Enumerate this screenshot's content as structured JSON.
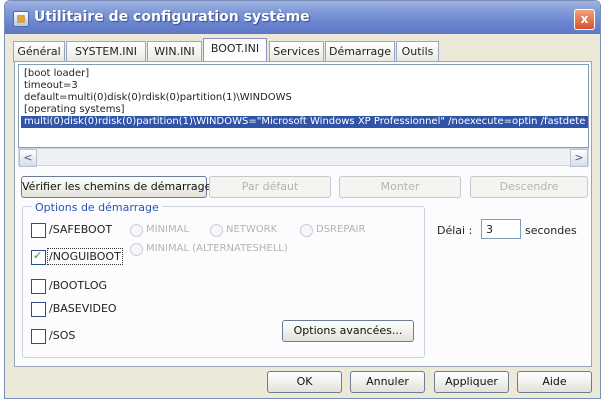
{
  "window": {
    "title": "Utilitaire de configuration système",
    "close_glyph": "x"
  },
  "tabs": [
    "Général",
    "SYSTEM.INI",
    "WIN.INI",
    "BOOT.INI",
    "Services",
    "Démarrage",
    "Outils"
  ],
  "active_tab": "BOOT.INI",
  "boot_ini": {
    "lines": [
      "[boot loader]",
      "timeout=3",
      "default=multi(0)disk(0)rdisk(0)partition(1)\\WINDOWS",
      "[operating systems]"
    ],
    "selected_line": "multi(0)disk(0)rdisk(0)partition(1)\\WINDOWS=\"Microsoft Windows XP Professionnel\" /noexecute=optin /fastdete"
  },
  "scroll": {
    "left_arrow": "<",
    "right_arrow": ">"
  },
  "buttons": {
    "check_paths": "Vérifier les chemins de démarrage",
    "default": "Par défaut",
    "up": "Monter",
    "down": "Descendre",
    "advanced": "Options avancées...",
    "ok": "OK",
    "cancel": "Annuler",
    "apply": "Appliquer",
    "help": "Aide"
  },
  "boot_options": {
    "group_label": "Options de démarrage",
    "checkboxes": [
      {
        "label": "/SAFEBOOT",
        "checked": false
      },
      {
        "label": "/NOGUIBOOT",
        "checked": true
      },
      {
        "label": "/BOOTLOG",
        "checked": false
      },
      {
        "label": "/BASEVIDEO",
        "checked": false
      },
      {
        "label": "/SOS",
        "checked": false
      }
    ],
    "radios": [
      {
        "label": "MINIMAL"
      },
      {
        "label": "NETWORK"
      },
      {
        "label": "DSREPAIR"
      },
      {
        "label": "MINIMAL (ALTERNATESHELL)"
      }
    ]
  },
  "delay": {
    "label": "Délai :",
    "value": "3",
    "unit": "secondes"
  }
}
